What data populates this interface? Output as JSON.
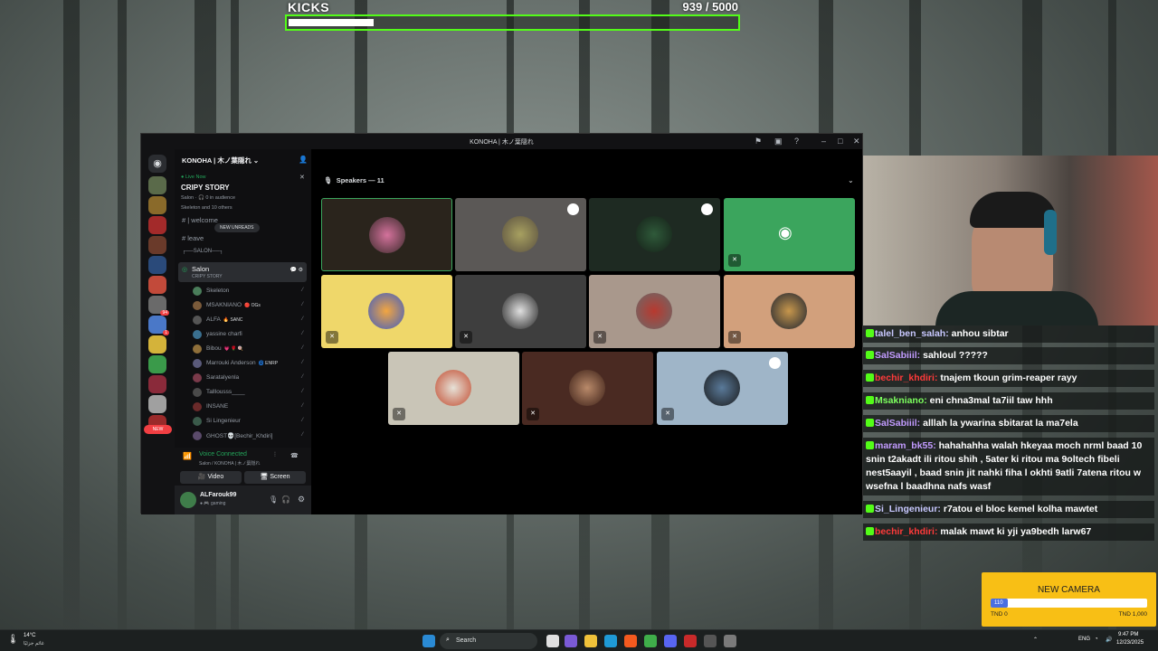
{
  "kicks": {
    "label": "KICKS",
    "count": "939 / 5000",
    "progress": 0.188
  },
  "discord": {
    "window_title": "KONOHA | 木ノ葉隠れ",
    "server_name": "KONOHA | 木ノ葉隠れ ⌄",
    "live_now": "● Live Now",
    "stage_title": "CRIPY STORY",
    "stage_sub": "Salon · 🎧 0 in audience",
    "stage_sub2": "Skeleton and 10 others",
    "channel_welcome": "| welcome",
    "new_unreads": "NEW UNREADS",
    "channel_leave": "leave",
    "category": "┌──SALON──┐",
    "salon_name": "Salon",
    "salon_sub": "CRIPY STORY",
    "members": [
      {
        "name": "Skeleton",
        "tag": "",
        "color": "#4a7d5a"
      },
      {
        "name": "MSAKNIANO",
        "tag": "🔴 OGs",
        "color": "#7a5a3a"
      },
      {
        "name": "ALFA",
        "tag": "🔥 SANC",
        "color": "#555555"
      },
      {
        "name": "yassine charfi",
        "tag": "",
        "color": "#3a6f8f"
      },
      {
        "name": "Bibou",
        "tag": "💗 🌹 🍭",
        "color": "#8f6f3a"
      },
      {
        "name": "Marrouki Anderson",
        "tag": "🌀 ENRP",
        "color": "#5a5a7a"
      },
      {
        "name": "Saratalyenla",
        "tag": "",
        "color": "#7a3a4a"
      },
      {
        "name": "Talllousss____",
        "tag": "",
        "color": "#4a4a4a"
      },
      {
        "name": "INSANE",
        "tag": "",
        "color": "#6a2a2a"
      },
      {
        "name": "Si Lingenieur",
        "tag": "",
        "color": "#3a5a4a"
      },
      {
        "name": "GHOST💀[Bechir_Khdiri]",
        "tag": "",
        "color": "#5a4a6a"
      }
    ],
    "voice_connected": "Voice Connected",
    "voice_sub": "Salon / KONOHA | 木ノ葉隠れ",
    "video_btn": "Video",
    "screen_btn": "Screen",
    "username": "ALFarouk99",
    "user_status": "● 🎮 gaming",
    "speakers_label": "Speakers — 11",
    "new_badge": "NEW",
    "rail_badges": [
      "",
      "",
      "",
      "",
      "",
      "",
      "94",
      "1",
      "",
      "",
      "",
      "",
      ""
    ]
  },
  "chat": [
    {
      "user": "talel_ben_salah",
      "color": "#c8c8ff",
      "text": " anhou sibtar"
    },
    {
      "user": "SalSabiiil",
      "color": "#c29bff",
      "text": " sahloul ?????"
    },
    {
      "user": "bechir_khdiri",
      "color": "#ff3a3a",
      "text": " tnajem tkoun grim-reaper rayy"
    },
    {
      "user": "Msakniano",
      "color": "#7cff5e",
      "text": " eni chna3mal ta7iil taw hhh"
    },
    {
      "user": "SalSabiiil",
      "color": "#c29bff",
      "text": " alllah la ywarina sbitarat la ma7ela"
    },
    {
      "user": "maram_bk55",
      "color": "#c29bff",
      "text": " hahahahha walah hkeyaa moch nrml baad 10 snin t2akadt ili ritou shih , 5ater ki ritou ma 9oltech fibeli nest5aayil , baad snin jit nahki fiha l okhti 9atli 7atena ritou w wsefna l baadhna nafs wasf"
    },
    {
      "user": "Si_Lingenieur",
      "color": "#c8c8ff",
      "text": " r7atou el bloc kemel kolha mawtet"
    },
    {
      "user": "bechir_khdiri",
      "color": "#ff3a3a",
      "text": " malak mawt ki yji ya9bedh larw67"
    }
  ],
  "goal": {
    "title": "NEW CAMERA",
    "amount": "110",
    "progress": 0.11,
    "min": "TND 0",
    "max": "TND 1,000"
  },
  "taskbar": {
    "temp": "14°C",
    "weather_note": "غائم جزئيًا",
    "search": "Search",
    "lang": "ENG",
    "time": "9:47 PM",
    "date": "12/23/2025"
  }
}
